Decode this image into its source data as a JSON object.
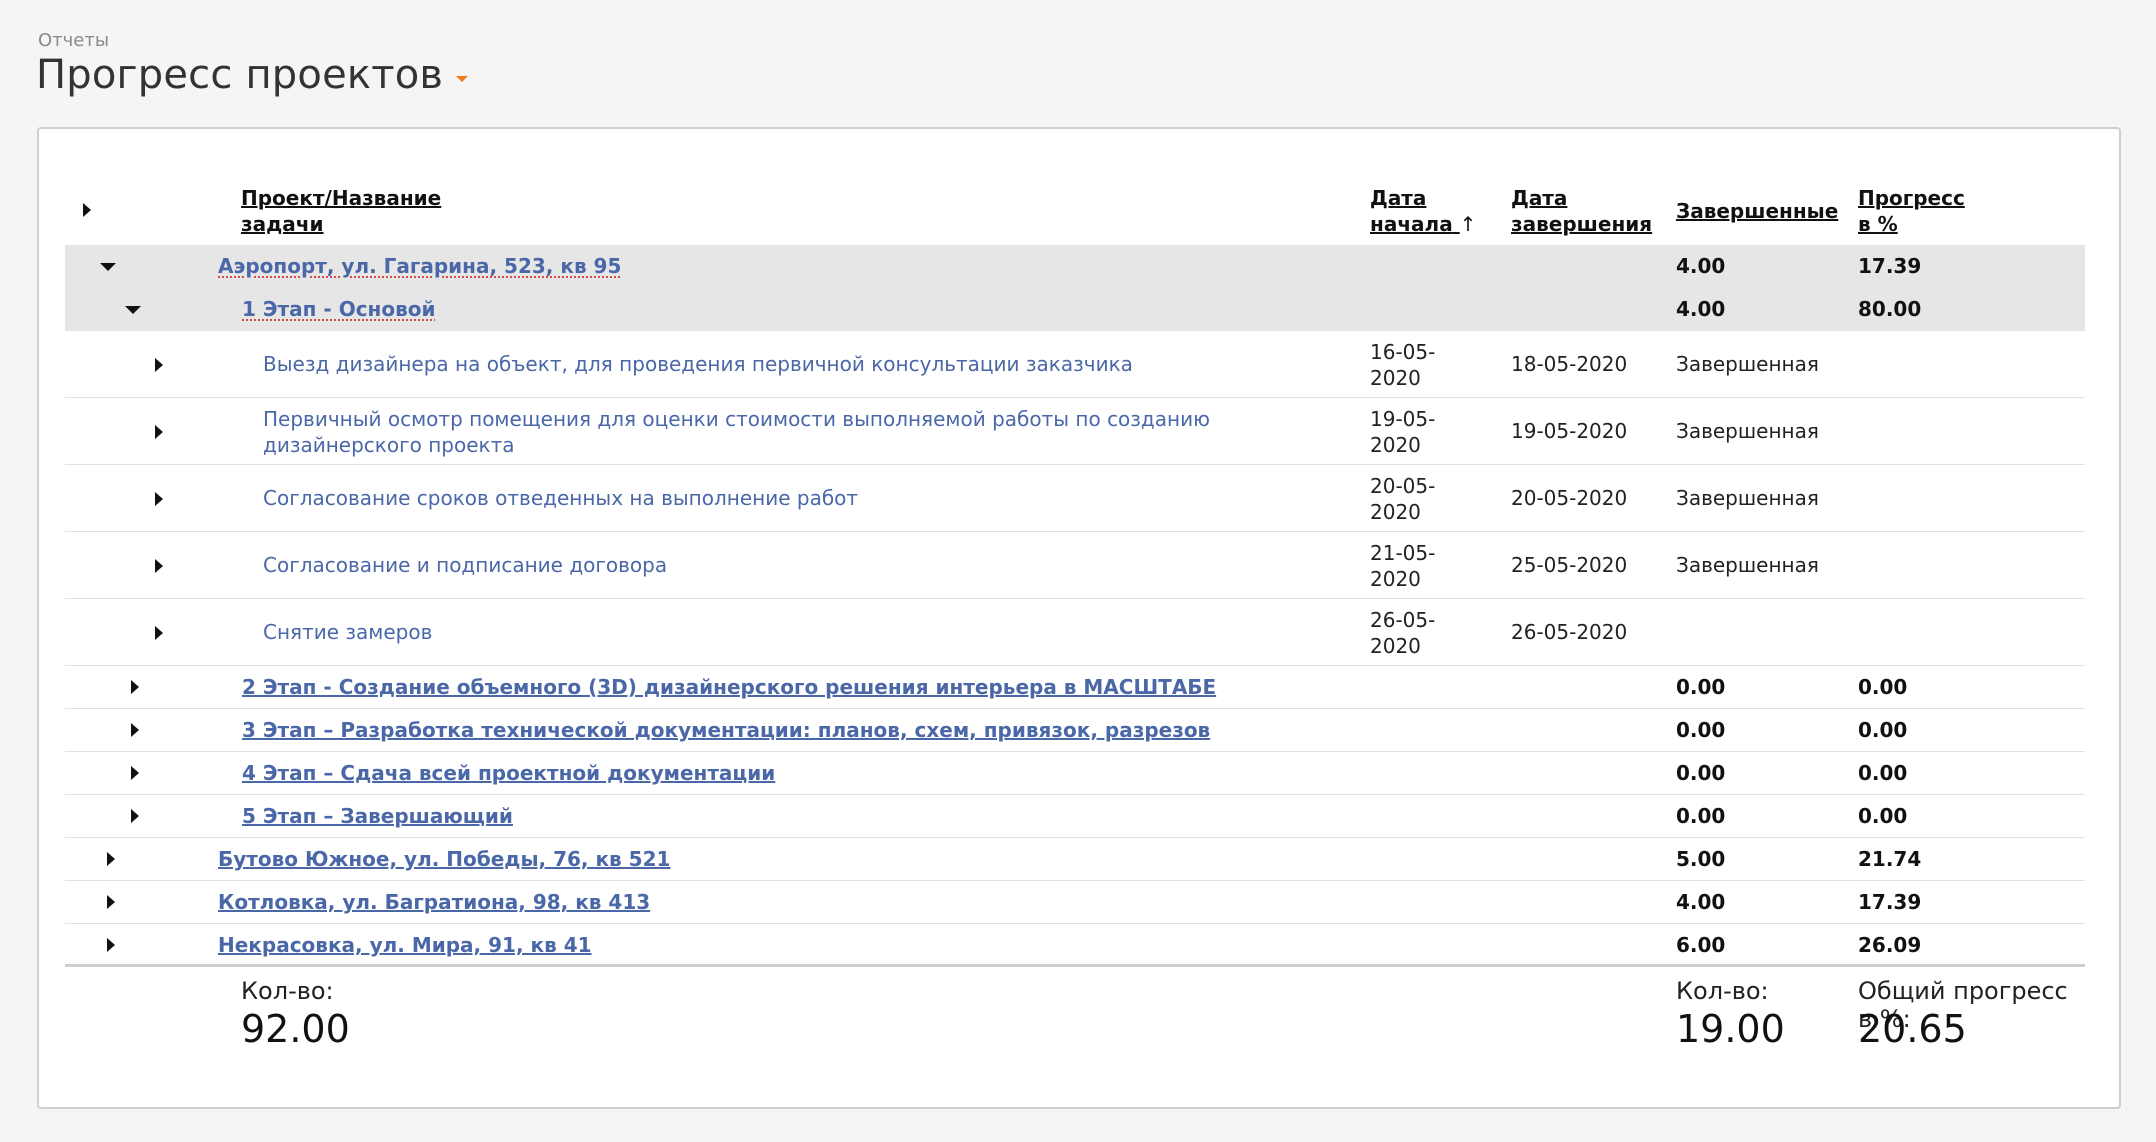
{
  "breadcrumb": "Отчеты",
  "page_title": "Прогресс проектов",
  "columns": {
    "name": "Проект/Название задачи",
    "name_line1": "Проект/Название",
    "name_line2": "задачи",
    "start_line1": "Дата",
    "start_line2": "начала",
    "sort_arrow": "↑",
    "end_line1": "Дата",
    "end_line2": "завершения",
    "done": "Завершенные",
    "progress_line1": "Прогресс",
    "progress_line2": "в %"
  },
  "project": {
    "name": "Аэропорт, ул. Гагарина, 523, кв 95",
    "done": "4.00",
    "progress": "17.39"
  },
  "stage1": {
    "name": "1 Этап - Основой",
    "done": "4.00",
    "progress": "80.00"
  },
  "tasks": [
    {
      "name": "Выезд дизайнера на объект, для проведения первичной консультации заказчика",
      "name2": "",
      "start1": "16-05-",
      "start2": "2020",
      "end": "18-05-2020",
      "status": "Завершенная"
    },
    {
      "name": "Первичный осмотр помещения для оценки стоимости выполняемой работы по созданию",
      "name2": "дизайнерского проекта",
      "start1": "19-05-",
      "start2": "2020",
      "end": "19-05-2020",
      "status": "Завершенная"
    },
    {
      "name": "Согласование сроков отведенных на выполнение работ",
      "name2": "",
      "start1": "20-05-",
      "start2": "2020",
      "end": "20-05-2020",
      "status": "Завершенная"
    },
    {
      "name": "Согласование и подписание договора",
      "name2": "",
      "start1": "21-05-",
      "start2": "2020",
      "end": "25-05-2020",
      "status": "Завершенная"
    },
    {
      "name": "Снятие замеров",
      "name2": "",
      "start1": "26-05-",
      "start2": "2020",
      "end": "26-05-2020",
      "status": ""
    }
  ],
  "stages": [
    {
      "name": "2 Этап - Создание объемного (3D) дизайнерского решения интерьера в МАСШТАБЕ",
      "done": "0.00",
      "progress": "0.00"
    },
    {
      "name": "3 Этап – Разработка технической документации: планов, схем, привязок, разрезов",
      "done": "0.00",
      "progress": "0.00"
    },
    {
      "name": "4 Этап – Сдача всей проектной документации",
      "done": "0.00",
      "progress": "0.00"
    },
    {
      "name": "5 Этап – Завершающий",
      "done": "0.00",
      "progress": "0.00"
    }
  ],
  "other_projects": [
    {
      "name": "Бутово Южное, ул. Победы, 76, кв 521",
      "done": "5.00",
      "progress": "21.74"
    },
    {
      "name": "Котловка, ул. Багратиона, 98, кв 413",
      "done": "4.00",
      "progress": "17.39"
    },
    {
      "name": "Некрасовка, ул. Мира, 91, кв 41",
      "done": "6.00",
      "progress": "26.09"
    }
  ],
  "footer": {
    "count_label": "Кол-во:",
    "count_value": "92.00",
    "done_label": "Кол-во:",
    "done_value": "19.00",
    "progress_label": "Общий прогресс в %:",
    "progress_value": "20.65"
  },
  "colors": {
    "link": "#4a67a8",
    "accent": "#f07c1b",
    "group_bg": "#e6e6e6"
  }
}
